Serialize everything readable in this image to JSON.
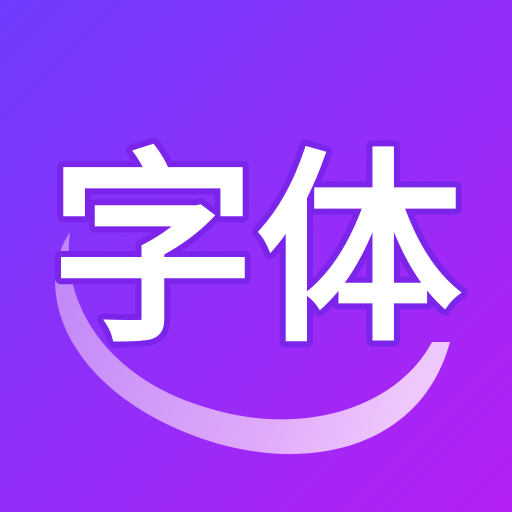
{
  "app_icon": {
    "glyph_text": "字体",
    "colors": {
      "gradient_start": "#6f3cff",
      "gradient_end": "#b51ff2",
      "glyph_fill": "#ffffff",
      "glyph_outline": "#7b24ea",
      "swoosh_light": "#f1c7fb",
      "swoosh_mid": "#cf98f6"
    }
  }
}
